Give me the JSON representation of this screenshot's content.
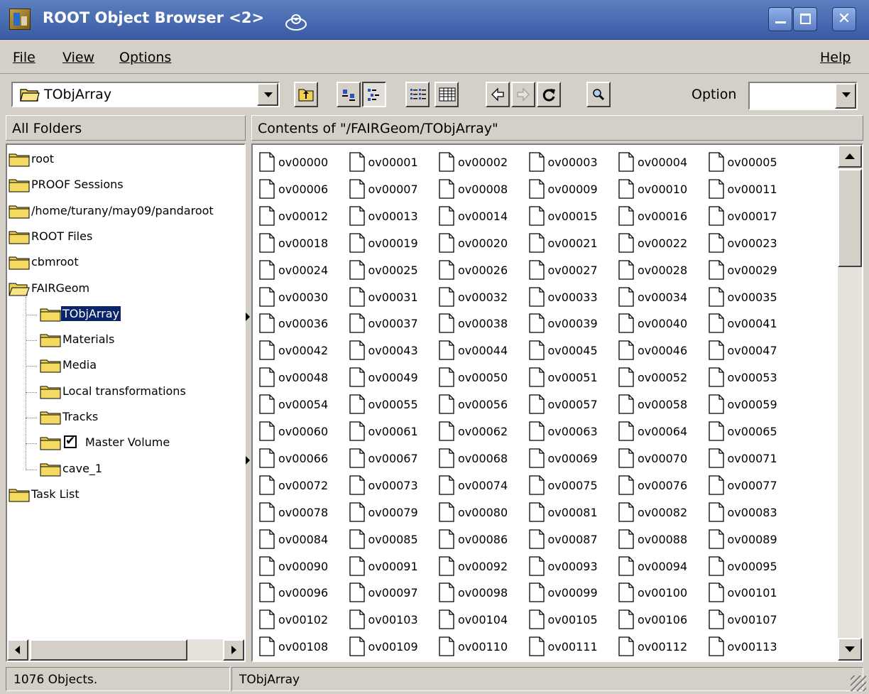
{
  "window": {
    "title": "ROOT Object Browser <2>"
  },
  "menu": {
    "file_label": "File",
    "view_label": "View",
    "options_label": "Options",
    "help_label": "Help"
  },
  "toolbar": {
    "path_value": "TObjArray",
    "option_label": "Option",
    "option_value": ""
  },
  "left_pane": {
    "header": "All Folders",
    "tree": [
      {
        "label": "root",
        "level": 0
      },
      {
        "label": "PROOF Sessions",
        "level": 0
      },
      {
        "label": "/home/turany/may09/pandaroot",
        "level": 0
      },
      {
        "label": "ROOT Files",
        "level": 0
      },
      {
        "label": "cbmroot",
        "level": 0
      },
      {
        "label": "FAIRGeom",
        "level": 0,
        "open": true
      },
      {
        "label": "TObjArray",
        "level": 1,
        "selected": true
      },
      {
        "label": "Materials",
        "level": 1
      },
      {
        "label": "Media",
        "level": 1
      },
      {
        "label": "Local transformations",
        "level": 1
      },
      {
        "label": "Tracks",
        "level": 1
      },
      {
        "label": "Master Volume",
        "level": 1,
        "checkbox": true,
        "checked": true
      },
      {
        "label": "cave_1",
        "level": 1
      },
      {
        "label": "Task List",
        "level": 0
      }
    ]
  },
  "right_pane": {
    "header": "Contents of \"/FAIRGeom/TObjArray\"",
    "items": [
      "ov00000",
      "ov00001",
      "ov00002",
      "ov00003",
      "ov00004",
      "ov00005",
      "ov00006",
      "ov00007",
      "ov00008",
      "ov00009",
      "ov00010",
      "ov00011",
      "ov00012",
      "ov00013",
      "ov00014",
      "ov00015",
      "ov00016",
      "ov00017",
      "ov00018",
      "ov00019",
      "ov00020",
      "ov00021",
      "ov00022",
      "ov00023",
      "ov00024",
      "ov00025",
      "ov00026",
      "ov00027",
      "ov00028",
      "ov00029",
      "ov00030",
      "ov00031",
      "ov00032",
      "ov00033",
      "ov00034",
      "ov00035",
      "ov00036",
      "ov00037",
      "ov00038",
      "ov00039",
      "ov00040",
      "ov00041",
      "ov00042",
      "ov00043",
      "ov00044",
      "ov00045",
      "ov00046",
      "ov00047",
      "ov00048",
      "ov00049",
      "ov00050",
      "ov00051",
      "ov00052",
      "ov00053",
      "ov00054",
      "ov00055",
      "ov00056",
      "ov00057",
      "ov00058",
      "ov00059",
      "ov00060",
      "ov00061",
      "ov00062",
      "ov00063",
      "ov00064",
      "ov00065",
      "ov00066",
      "ov00067",
      "ov00068",
      "ov00069",
      "ov00070",
      "ov00071",
      "ov00072",
      "ov00073",
      "ov00074",
      "ov00075",
      "ov00076",
      "ov00077",
      "ov00078",
      "ov00079",
      "ov00080",
      "ov00081",
      "ov00082",
      "ov00083",
      "ov00084",
      "ov00085",
      "ov00086",
      "ov00087",
      "ov00088",
      "ov00089",
      "ov00090",
      "ov00091",
      "ov00092",
      "ov00093",
      "ov00094",
      "ov00095",
      "ov00096",
      "ov00097",
      "ov00098",
      "ov00099",
      "ov00100",
      "ov00101",
      "ov00102",
      "ov00103",
      "ov00104",
      "ov00105",
      "ov00106",
      "ov00107",
      "ov00108",
      "ov00109",
      "ov00110",
      "ov00111",
      "ov00112",
      "ov00113"
    ]
  },
  "status": {
    "count": "1076 Objects.",
    "path": "TObjArray"
  },
  "colors": {
    "titlebar": "#3a5ba5",
    "selection": "#0a246a",
    "folder": "#f0d050"
  }
}
